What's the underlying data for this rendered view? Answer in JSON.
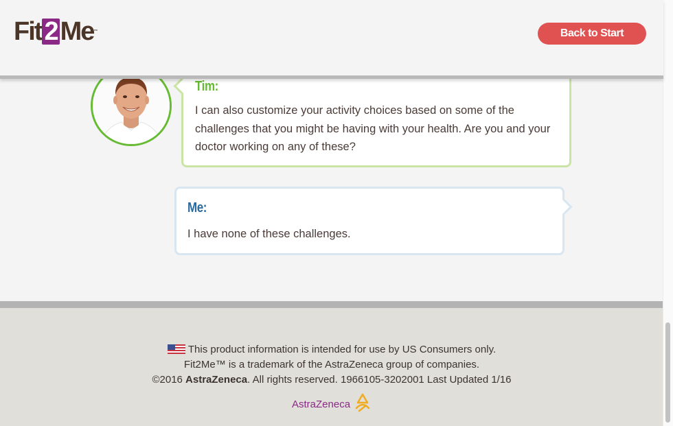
{
  "header": {
    "logo": {
      "prefix": "Fit",
      "highlight": "2",
      "suffix": "Me",
      "tm": "™"
    },
    "back_button": "Back to Start"
  },
  "chat": {
    "tim": {
      "speaker": "Tim:",
      "message": "I can also customize your activity choices based on some of the challenges that you might be having with your health. Are you and your doctor working on any of these?"
    },
    "me": {
      "speaker": "Me:",
      "message": "I have none of these challenges."
    }
  },
  "footer": {
    "line1": "This product information is intended for use by US Consumers only.",
    "line2": "Fit2Me™ is a trademark of the AstraZeneca group of companies.",
    "line3_prefix": "©2016 ",
    "line3_brand": "AstraZeneca",
    "line3_suffix": ". All rights reserved. 1966105-3202001 Last Updated 1/16",
    "brand_logo": "AstraZeneca"
  },
  "colors": {
    "accent_red": "#e05252",
    "tim_green": "#66bb33",
    "me_blue": "#2a6aa0",
    "brand_purple": "#8a2a86"
  }
}
